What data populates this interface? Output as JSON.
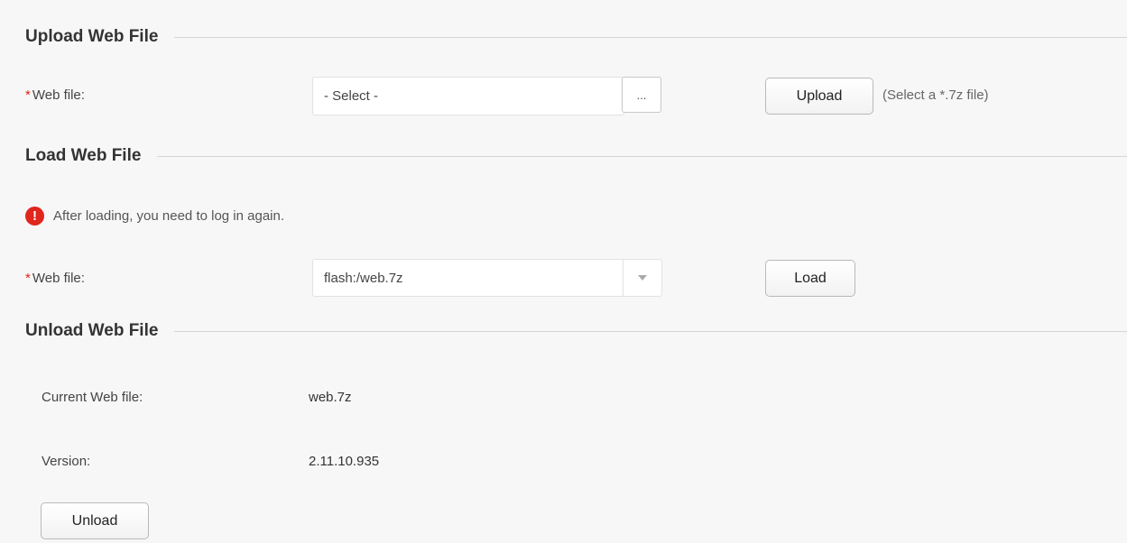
{
  "upload_section": {
    "title": "Upload Web File",
    "web_file_label": "Web file:",
    "required_mark": "*",
    "file_input_value": "- Select -",
    "browse_label": "...",
    "upload_button": "Upload",
    "hint": "(Select a *.7z file)"
  },
  "load_section": {
    "title": "Load Web File",
    "warning_icon": "exclamation-icon",
    "warning_glyph": "!",
    "warning_text": "After loading, you need to log in again.",
    "web_file_label": "Web file:",
    "required_mark": "*",
    "selected_file": "flash:/web.7z",
    "dropdown_icon": "chevron-down-icon",
    "load_button": "Load"
  },
  "unload_section": {
    "title": "Unload Web File",
    "current_label": "Current Web file:",
    "current_value": "web.7z",
    "version_label": "Version:",
    "version_value": "2.11.10.935",
    "unload_button": "Unload"
  },
  "colors": {
    "background": "#f7f7f7",
    "required": "#e0261d",
    "warning": "#e0261d"
  }
}
